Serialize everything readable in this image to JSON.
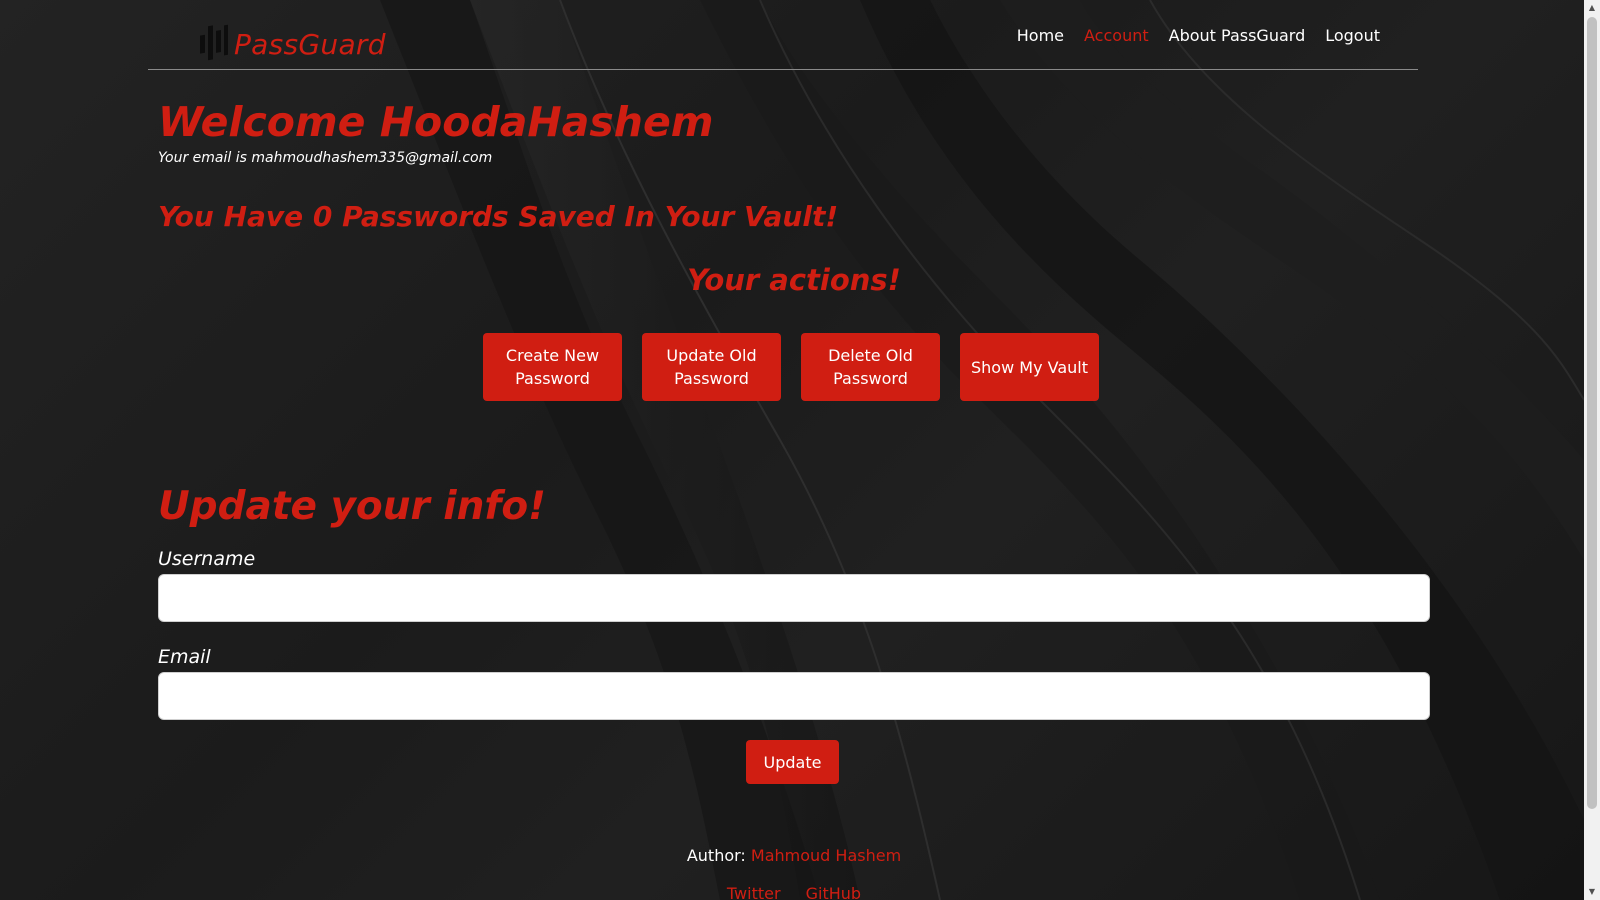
{
  "brand": {
    "name": "PassGuard",
    "icon": "passguard-logo-icon"
  },
  "nav": {
    "items": [
      {
        "label": "Home",
        "active": false
      },
      {
        "label": "Account",
        "active": true
      },
      {
        "label": "About PassGuard",
        "active": false
      },
      {
        "label": "Logout",
        "active": false
      }
    ]
  },
  "welcome": {
    "title": "Welcome HoodaHashem",
    "email_line": "Your email is mahmoudhashem335@gmail.com"
  },
  "vault": {
    "count_text": "You Have 0 Passwords Saved In Your Vault!"
  },
  "actions": {
    "title": "Your actions!",
    "buttons": [
      {
        "label": "Create New Password"
      },
      {
        "label": "Update Old Password"
      },
      {
        "label": "Delete Old Password"
      },
      {
        "label": "Show My Vault"
      }
    ]
  },
  "update_form": {
    "title": "Update your info!",
    "username_label": "Username",
    "username_value": "",
    "email_label": "Email",
    "email_value": "",
    "submit_label": "Update"
  },
  "footer": {
    "author_prefix": "Author:",
    "author_name": "Mahmoud Hashem",
    "links": [
      {
        "label": "Twitter"
      },
      {
        "label": "GitHub"
      }
    ]
  },
  "colors": {
    "accent": "#d01e12",
    "background": "#1c1c1c",
    "text": "#ffffff"
  }
}
